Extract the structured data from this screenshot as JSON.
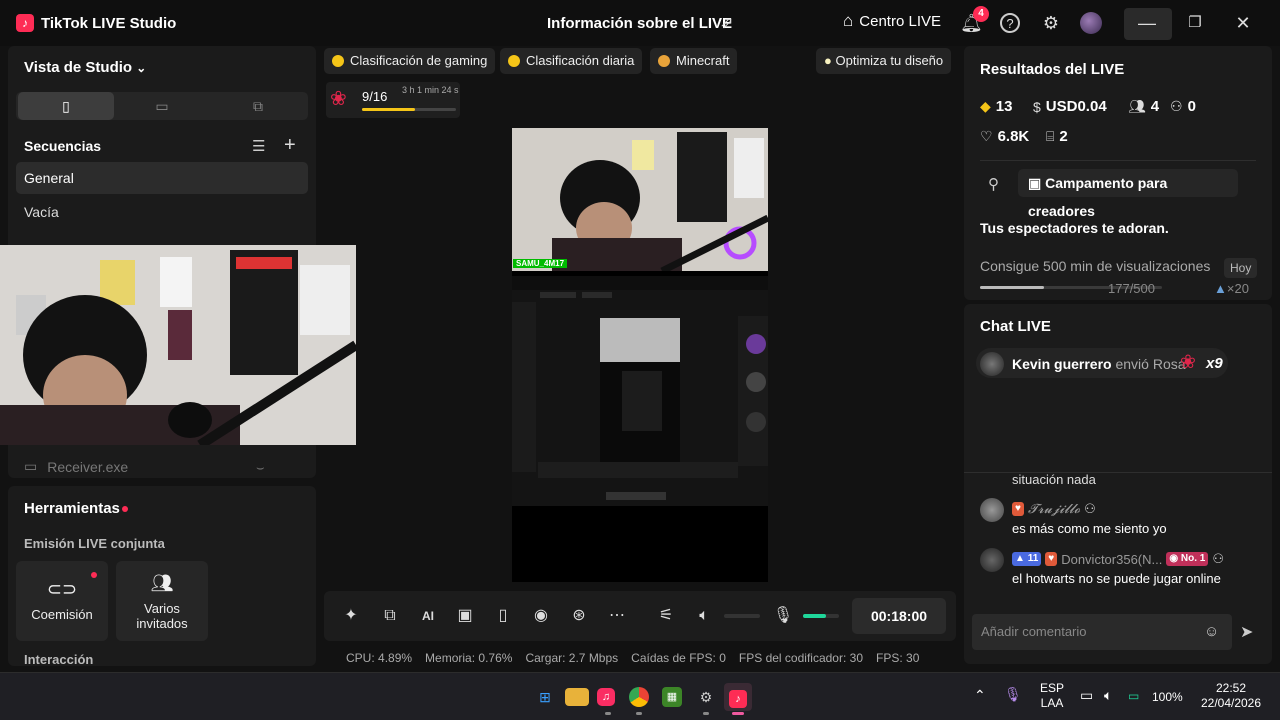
{
  "titlebar": {
    "app_name": "TikTok LIVE Studio",
    "center_title": "Información sobre el LIVE",
    "live_center": "Centro LIVE",
    "notif_count": "4",
    "icons": [
      "share-icon",
      "home-icon",
      "bell-icon",
      "help-icon",
      "settings-icon",
      "minimize-icon",
      "restore-icon",
      "close-icon"
    ]
  },
  "studio": {
    "title": "Vista de Studio",
    "sequences_title": "Secuencias",
    "sequences": [
      "General",
      "Vacía"
    ],
    "receiver": "Receiver.exe"
  },
  "tools": {
    "title": "Herramientas",
    "cohost_title": "Emisión LIVE conjunta",
    "cards": [
      "Coemisión",
      "Varios invitados"
    ],
    "interaction": "Interacción"
  },
  "chips": [
    "Clasificación de gaming",
    "Clasificación diaria",
    "Minecraft"
  ],
  "optimize": "Optimiza tu diseño",
  "gift_goal": {
    "count": "9/16",
    "time": "3 h 1 min 24 s",
    "progress": 0.5625
  },
  "stage": {
    "tag": "SAMU_4M17"
  },
  "controls": {
    "timer": "00:18:00",
    "mic_level": 0.65,
    "icons": [
      "magic-icon",
      "screen-share-icon",
      "ai-icon",
      "camera-icon",
      "mobile-icon",
      "record-icon",
      "broadcast-icon",
      "more-icon",
      "adjust-icon",
      "volume-icon",
      "mic-icon"
    ]
  },
  "stats": [
    {
      "label": "CPU:",
      "value": "4.89%"
    },
    {
      "label": "Memoria:",
      "value": "0.76%"
    },
    {
      "label": "Cargar:",
      "value": "2.7 Mbps"
    },
    {
      "label": "Caídas de FPS:",
      "value": "0"
    },
    {
      "label": "FPS del codificador:",
      "value": "30"
    },
    {
      "label": "FPS:",
      "value": "30"
    }
  ],
  "results": {
    "title": "Resultados del LIVE",
    "diamonds": "13",
    "usd": "USD0.04",
    "viewers": "4",
    "new_followers": "0",
    "likes": "6.8K",
    "gifters": "2",
    "campaign": "Campamento para creadores",
    "adore": "Tus espectadores te adoran.",
    "goal_text": "Consigue 500 min de visualizaciones",
    "goal_badge": "Hoy",
    "goal_count": "177/500",
    "goal_progress": 0.354,
    "goal_reward": "×20"
  },
  "chat": {
    "title": "Chat LIVE",
    "gift_user": "Kevin guerrero",
    "gift_action": "envió Rosa",
    "gift_mult": "x9",
    "partial_msg": "situación nada",
    "messages": [
      {
        "name": "𝓣𝓻𝓾𝓳𝓲𝓵𝓵𝓸",
        "text": "es más como me siento yo"
      },
      {
        "name": "Donvictor356(N...",
        "level": "11",
        "rank": "No. 1",
        "text": "el hotwarts no se puede jugar online"
      }
    ],
    "placeholder": "Añadir comentario"
  },
  "taskbar": {
    "lang1": "ESP",
    "lang2": "LAA",
    "battery": "100%",
    "time": "22:52",
    "date": "22/04/2026"
  }
}
